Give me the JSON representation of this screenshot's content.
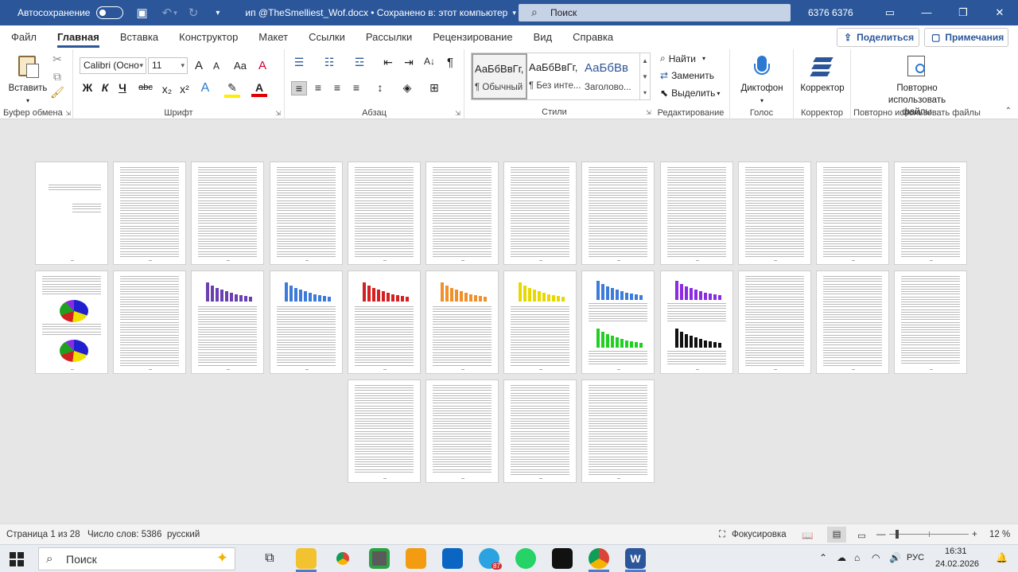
{
  "titlebar": {
    "autosave_label": "Автосохранение",
    "document_title": "ип @TheSmelliest_Wof.docx  •  Сохранено в: этот компьютер",
    "search_placeholder": "Поиск",
    "user_name": "6376 6376"
  },
  "tabs": [
    "Файл",
    "Главная",
    "Вставка",
    "Конструктор",
    "Макет",
    "Ссылки",
    "Рассылки",
    "Рецензирование",
    "Вид",
    "Справка"
  ],
  "share_label": "Поделиться",
  "comments_label": "Примечания",
  "ribbon": {
    "clipboard": {
      "paste_label": "Вставить",
      "group_label": "Буфер обмена"
    },
    "font": {
      "font_name": "Calibri (Осно",
      "font_size": "11",
      "bold": "Ж",
      "italic": "К",
      "underline": "Ч",
      "strike": "abc",
      "sub": "x₂",
      "sup": "x²",
      "grow": "A",
      "shrink": "A",
      "case": "Aa",
      "clear": "A",
      "text_effects": "A",
      "group_label": "Шрифт"
    },
    "paragraph": {
      "group_label": "Абзац",
      "pilcrow": "¶"
    },
    "styles": {
      "group_label": "Стили",
      "items": [
        {
          "preview": "АаБбВвГг,",
          "name": "¶ Обычный"
        },
        {
          "preview": "АаБбВвГг,",
          "name": "¶ Без инте..."
        },
        {
          "preview": "АаБбВв",
          "name": "Заголово..."
        }
      ]
    },
    "editing": {
      "find": "Найти",
      "replace": "Заменить",
      "select": "Выделить",
      "group_label": "Редактирование"
    },
    "voice": {
      "dictate": "Диктофон",
      "group_label": "Голос"
    },
    "editor": {
      "label": "Корректор",
      "group_label": "Корректор"
    },
    "reuse": {
      "label": "Повторно использовать файлы",
      "group_label": "Повторно использовать файлы"
    }
  },
  "pages": {
    "count": 28,
    "chart_colors": [
      "#6a3fb0",
      "#3c7bd9",
      "#d42020",
      "#f0902a",
      "#e8d800",
      "#3c7bd9",
      "#20d020",
      "#8a2be2",
      "#c8c8c8",
      "#111111"
    ],
    "pie_colors": [
      "#2020d0",
      "#f0e000",
      "#d02020",
      "#20a020",
      "#8a2be2"
    ]
  },
  "statusbar": {
    "page_info": "Страница 1 из 28",
    "word_count": "Число слов: 5386",
    "language": "русский",
    "focus": "Фокусировка",
    "zoom": "12 %"
  },
  "taskbar": {
    "search_placeholder": "Поиск",
    "language": "РУС",
    "time": "16:31",
    "date": "24.02.2026",
    "telegram_badge": "87"
  }
}
